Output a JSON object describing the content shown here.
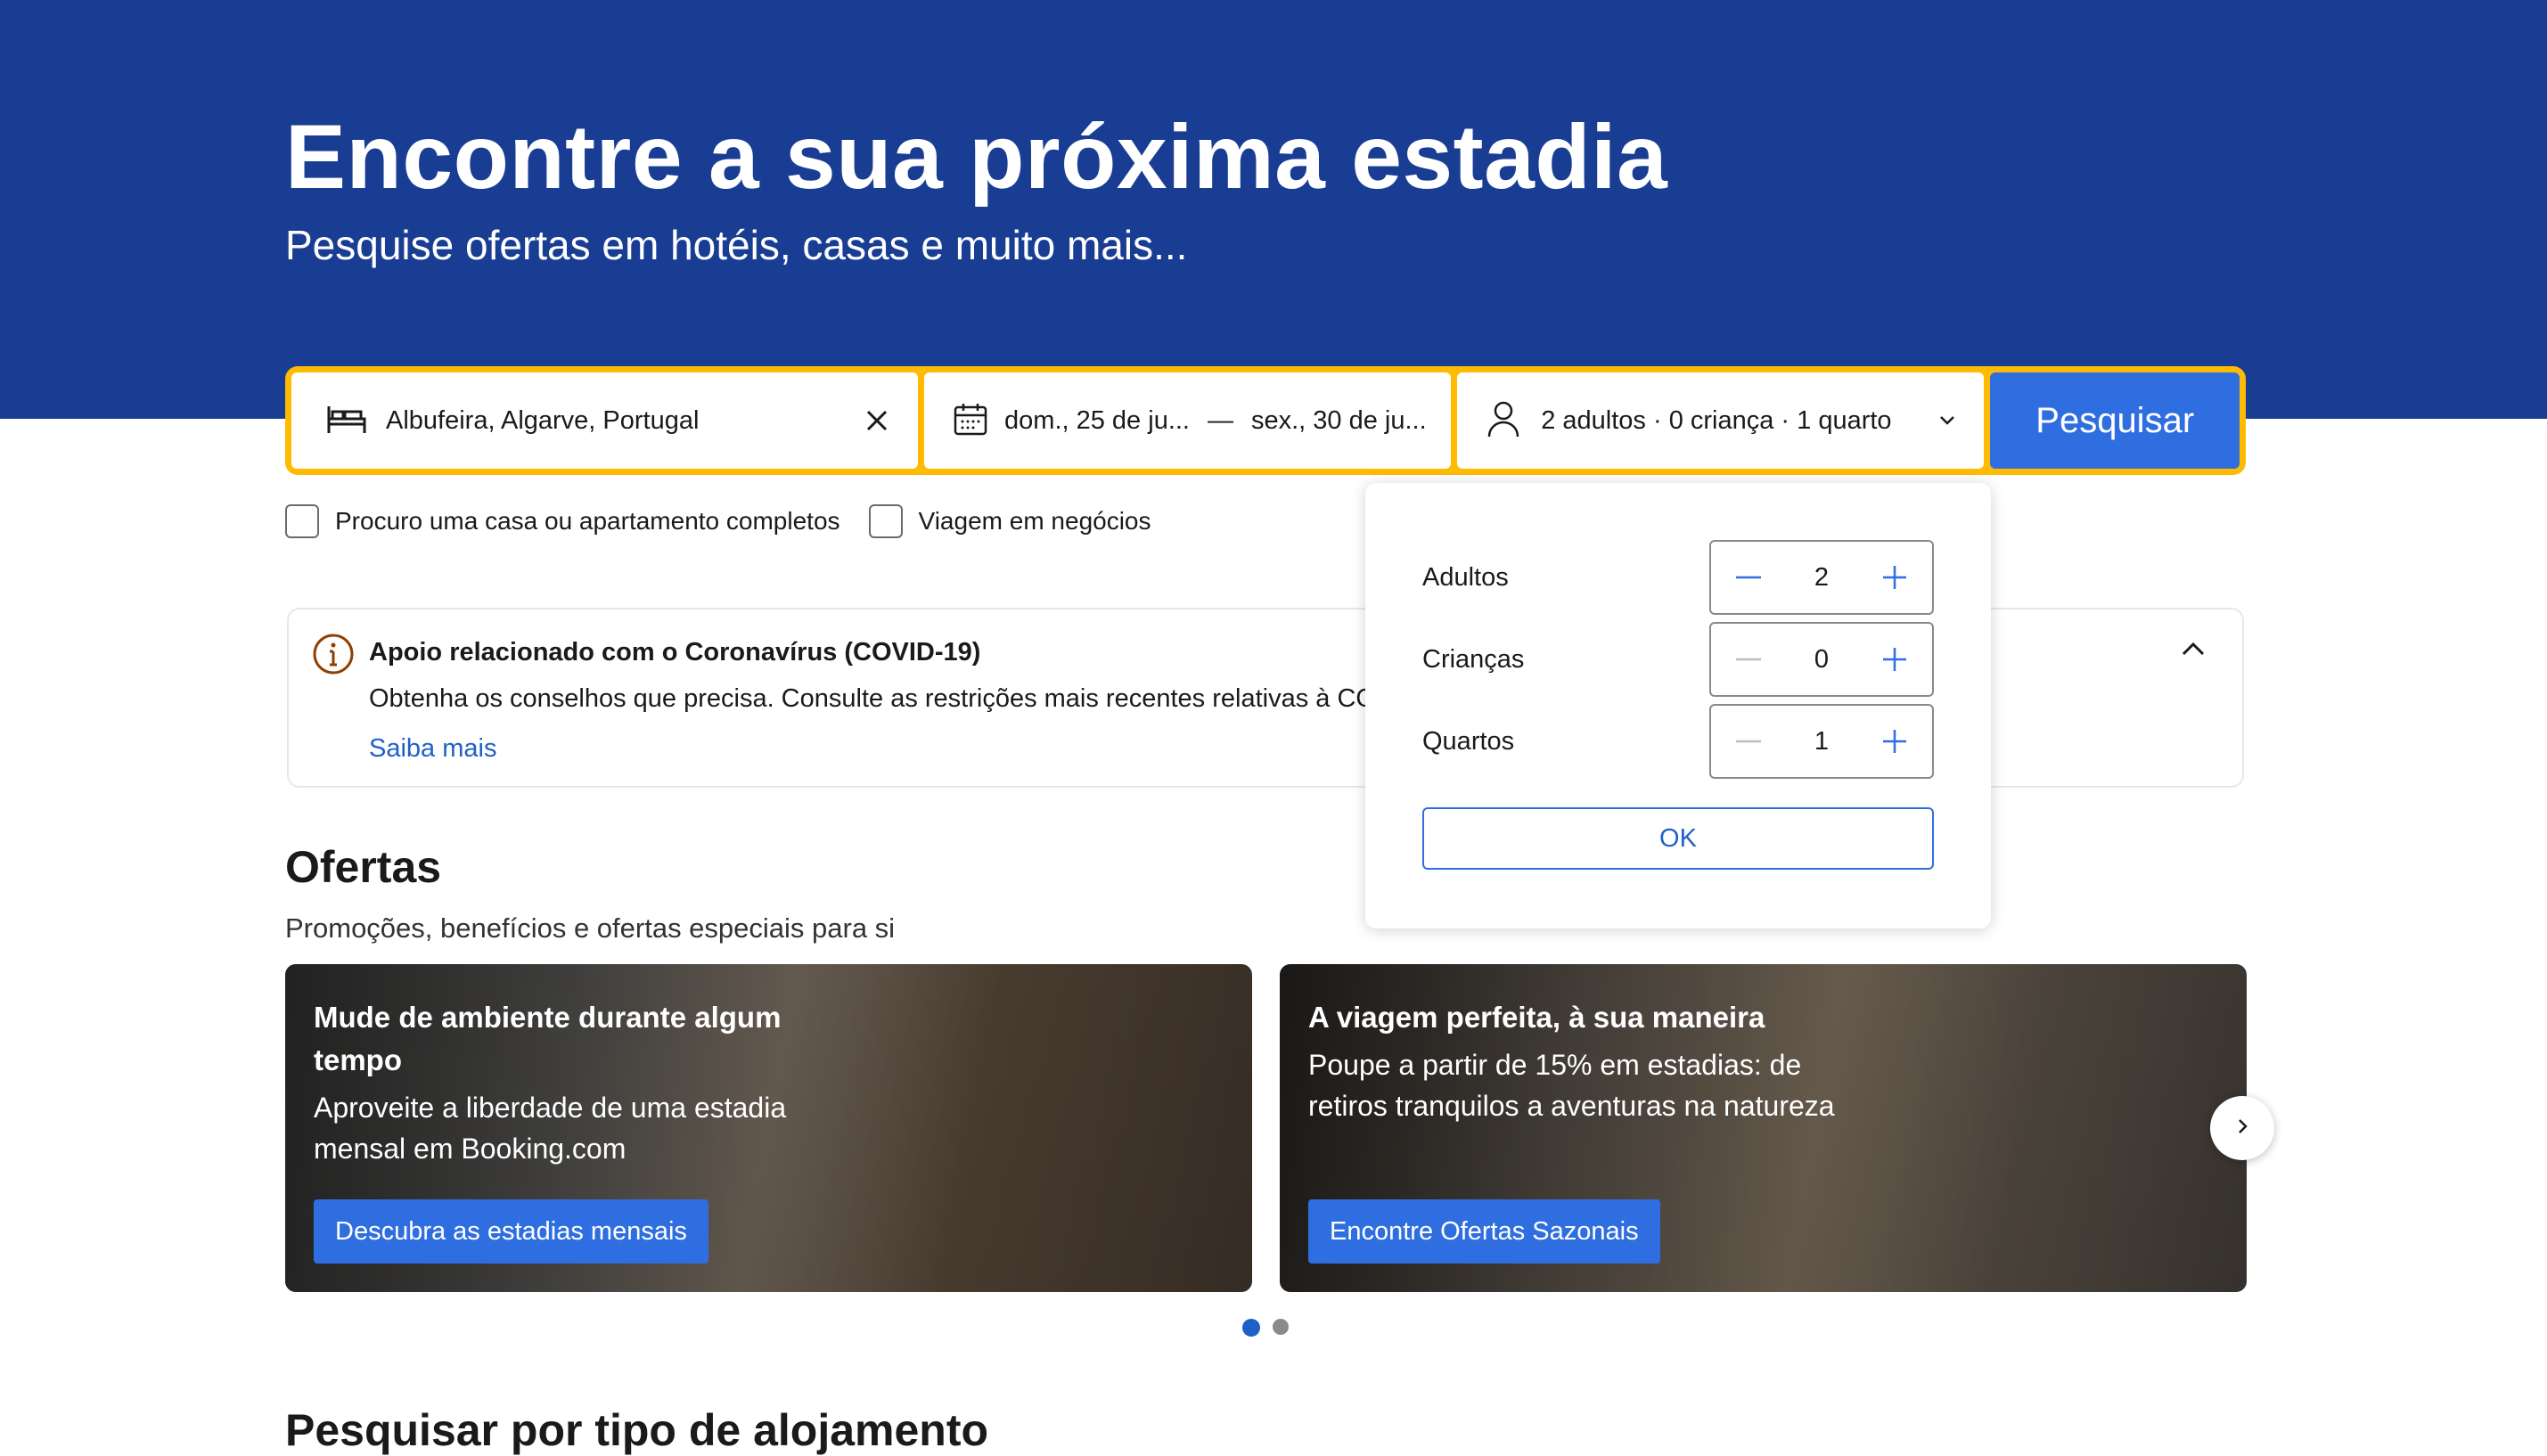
{
  "hero": {
    "title": "Encontre a sua próxima estadia",
    "subtitle": "Pesquise ofertas em hotéis, casas e muito mais..."
  },
  "search": {
    "destination": "Albufeira, Algarve, Portugal",
    "checkin": "dom., 25 de ju...",
    "separator": "—",
    "checkout": "sex., 30 de ju...",
    "guests": "2 adultos · 0 criança · 1 quarto",
    "button": "Pesquisar"
  },
  "checks": [
    {
      "label": "Procuro uma casa ou apartamento completos"
    },
    {
      "label": "Viagem em negócios"
    }
  ],
  "covid": {
    "title": "Apoio relacionado com o Coronavírus (COVID-19)",
    "text": "Obtenha os conselhos que precisa. Consulte as restrições mais recentes relativas à COVID-19 antes de viajar.",
    "link": "Saiba mais"
  },
  "offers": {
    "title": "Ofertas",
    "subtitle": "Promoções, benefícios e ofertas especiais para si",
    "cards": [
      {
        "title": "Mude de ambiente durante algum tempo",
        "text": "Aproveite a liberdade de uma estadia mensal em Booking.com",
        "button": "Descubra as estadias mensais"
      },
      {
        "title": "A viagem perfeita, à sua maneira",
        "text": "Poupe a partir de 15% em estadias: de retiros tranquilos a aventuras na natureza",
        "button": "Encontre Ofertas Sazonais"
      }
    ]
  },
  "section2": {
    "title": "Pesquisar por tipo de alojamento"
  },
  "occupancy": {
    "rows": [
      {
        "label": "Adultos",
        "value": "2"
      },
      {
        "label": "Crianças",
        "value": "0"
      },
      {
        "label": "Quartos",
        "value": "1"
      }
    ],
    "ok": "OK"
  },
  "colors": {
    "brand": "#1a3d94",
    "accent": "#febb02",
    "button": "#2f6ee0"
  }
}
